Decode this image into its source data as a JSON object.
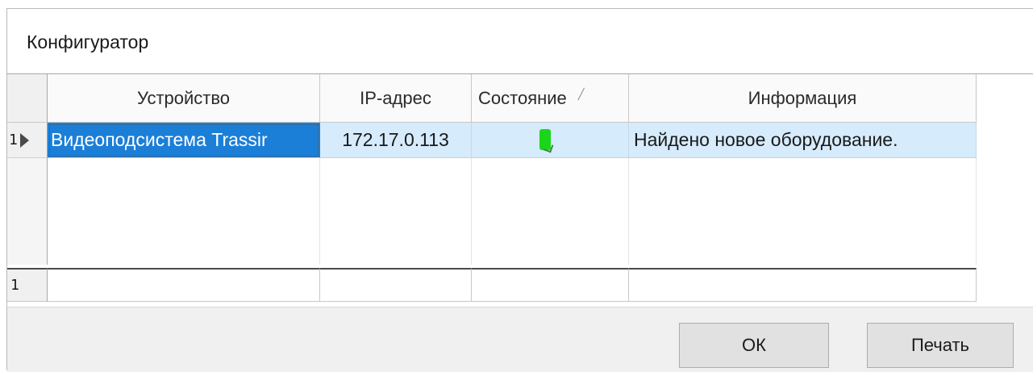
{
  "window": {
    "title": "Конфигуратор"
  },
  "grid": {
    "columns": [
      "Устройство",
      "IP-адрес",
      "Состояние",
      "Информация"
    ],
    "sorted_column": "Состояние",
    "rows": [
      {
        "row_number": "1",
        "device": "Видеоподсистема Trassir",
        "ip": "172.17.0.113",
        "state_icon": "green-status-icon",
        "info": "Найдено новое оборудование."
      }
    ],
    "footer_count": "1"
  },
  "buttons": {
    "ok": "ОК",
    "print": "Печать"
  },
  "colors": {
    "selected_cell": "#1b7fd8",
    "selected_row": "#d6ebfb",
    "status_green": "#1ad61a"
  }
}
